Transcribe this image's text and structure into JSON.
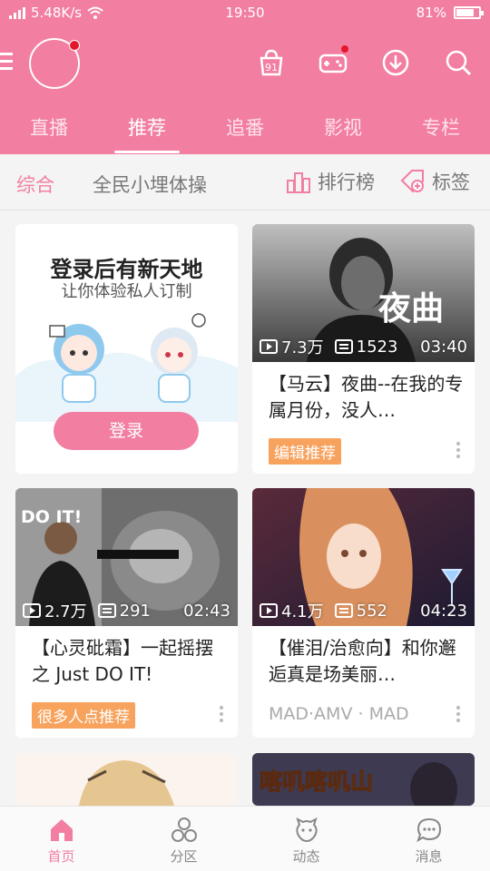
{
  "status_bar": {
    "network_speed": "5.48K/s",
    "time": "19:50",
    "battery": "81%",
    "battery_level": 0.81
  },
  "header": {
    "tabs": [
      {
        "label": "直播",
        "active": false
      },
      {
        "label": "推荐",
        "active": true
      },
      {
        "label": "追番",
        "active": false
      },
      {
        "label": "影视",
        "active": false
      },
      {
        "label": "专栏",
        "active": false
      }
    ],
    "icons": [
      "menu-icon",
      "avatar",
      "game-center-icon",
      "game-controller-icon",
      "download-icon",
      "search-icon"
    ]
  },
  "subnav": {
    "comprehensive": "综合",
    "campaign": "全民小埋体操",
    "ranking": "排行榜",
    "tags": "标签"
  },
  "login_card": {
    "title": "登录后有新天地",
    "subtitle": "让你体验私人订制",
    "button": "登录"
  },
  "cards": [
    {
      "title": "【马云】夜曲--在我的专属月份，没人…",
      "views": "7.3万",
      "danmaku": "1523",
      "duration": "03:40",
      "badge": "编辑推荐",
      "thumb_text": "夜曲"
    },
    {
      "title": "【心灵砒霜】一起摇摆之 Just DO IT!",
      "views": "2.7万",
      "danmaku": "291",
      "duration": "02:43",
      "badge": "很多人点推荐",
      "thumb_text": "DO IT!"
    },
    {
      "title": "【催泪/治愈向】和你邂逅真是场美丽…",
      "views": "4.1万",
      "danmaku": "552",
      "duration": "04:23",
      "tag": "MAD·AMV · MAD"
    },
    {
      "thumb_text": "喀叽喀叽山"
    }
  ],
  "bottom_nav": [
    {
      "label": "首页",
      "active": true
    },
    {
      "label": "分区",
      "active": false
    },
    {
      "label": "动态",
      "active": false
    },
    {
      "label": "消息",
      "active": false
    }
  ],
  "colors": {
    "brand": "#f27ea1",
    "badge": "#f7a35e"
  }
}
